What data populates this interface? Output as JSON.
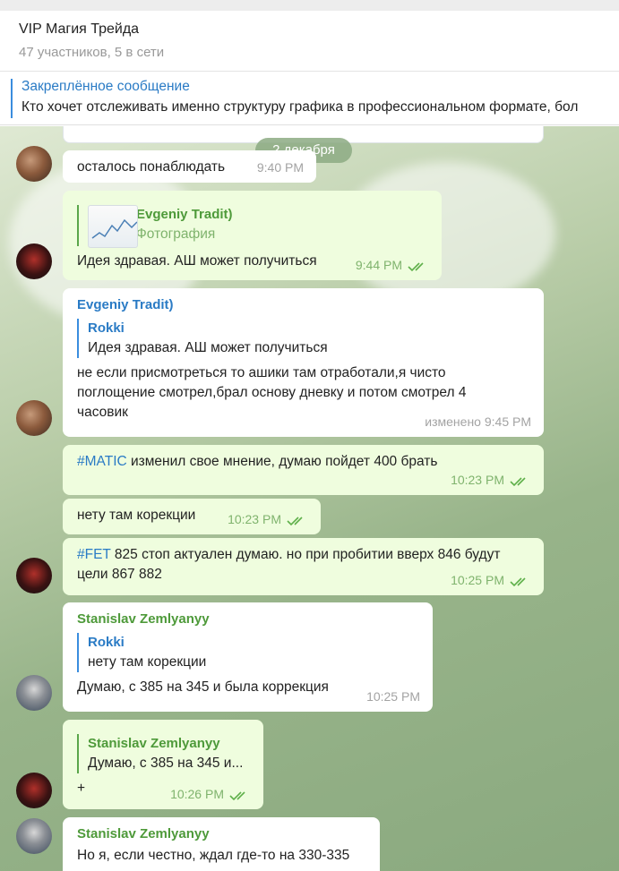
{
  "header": {
    "title": "VIP Магия Трейда",
    "subtitle": "47 участников, 5 в сети"
  },
  "pinned": {
    "title": "Закреплённое сообщение",
    "text": "Кто хочет отслеживать именно структуру графика в профессиональном формате, бол"
  },
  "date_divider": "2 декабря",
  "messages": [
    {
      "text": "осталось понаблюдать",
      "time": "9:40 PM"
    },
    {
      "reply_name": "Evgeniy Tradit)",
      "reply_text": "Фотография",
      "text": "Идея здравая. АШ может получиться",
      "time": "9:44 PM"
    },
    {
      "sender": "Evgeniy Tradit)",
      "reply_name": "Rokki",
      "reply_text": "Идея здравая. АШ может получиться",
      "text": "не если присмотреться то ашики там отработали,я чисто поглощение смотрел,брал основу дневку и потом смотрел 4 часовик",
      "line1": "не если присмотреться то ашики там отработали,я чисто",
      "line2": "поглощение смотрел,брал основу дневку и потом смотрел 4",
      "line3": "часовик",
      "time": "изменено 9:45 PM"
    },
    {
      "tag": "#MATIC",
      "text": " изменил свое мнение, думаю пойдет 400 брать",
      "time": "10:23 PM"
    },
    {
      "text": "нету там корекции",
      "time": "10:23 PM"
    },
    {
      "tag": "#FET",
      "line1": " 825 стоп актуален думаю. но при пробитии вверх 846 будут",
      "line2": "цели 867 882",
      "time": "10:25 PM"
    },
    {
      "sender": "Stanislav Zemlyanyy",
      "reply_name": "Rokki",
      "reply_text": "нету там корекции",
      "text": "Думаю, с 385 на 345 и была коррекция",
      "time": "10:25 PM"
    },
    {
      "reply_name": "Stanislav Zemlyanyy",
      "reply_text": "Думаю, с 385 на 345 и...",
      "text": "+",
      "time": "10:26 PM"
    },
    {
      "sender": "Stanislav Zemlyanyy",
      "text": "Но я, если честно, ждал где-то на 330-335"
    }
  ],
  "colors": {
    "accent": "#2a7bc5",
    "outgoing_bubble": "#effdde",
    "green_name": "#4e9a3a"
  },
  "icons": [
    "double-check-icon"
  ]
}
